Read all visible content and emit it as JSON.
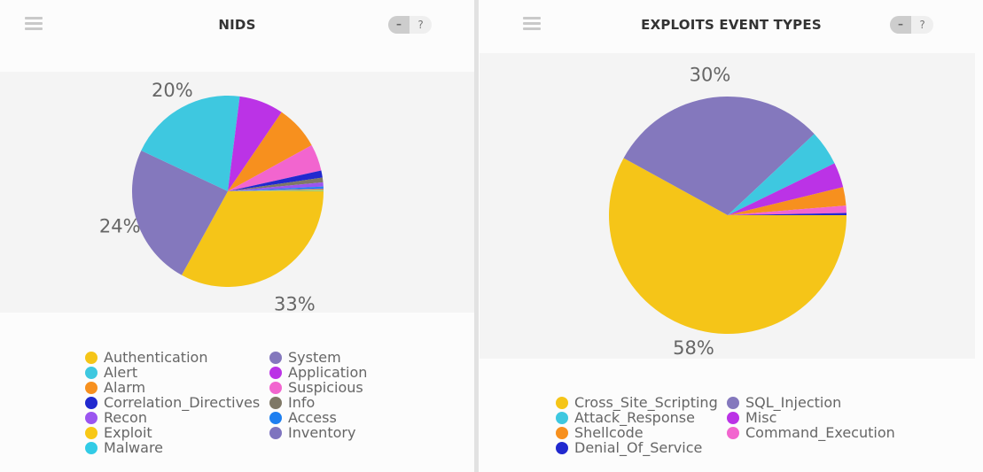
{
  "panels": [
    {
      "title": "NIDS",
      "controls": {
        "minimize_label": "–",
        "help_label": "?"
      },
      "icons": {
        "menu": "hamburger-menu-icon"
      }
    },
    {
      "title": "EXPLOITS EVENT TYPES",
      "controls": {
        "minimize_label": "–",
        "help_label": "?"
      },
      "icons": {
        "menu": "hamburger-menu-icon"
      }
    }
  ],
  "chart_data": [
    {
      "type": "pie",
      "title": "NIDS",
      "start_angle": "3 o'clock, clockwise",
      "slices": [
        {
          "label": "Authentication",
          "value": 33,
          "color": "#f5c518",
          "data_label": "33%"
        },
        {
          "label": "System",
          "value": 24,
          "color": "#8478bd",
          "data_label": "24%"
        },
        {
          "label": "Alert",
          "value": 20,
          "color": "#3ec8e0",
          "data_label": "20%"
        },
        {
          "label": "Application",
          "value": 7.5,
          "color": "#bb33e6",
          "data_label": ""
        },
        {
          "label": "Alarm",
          "value": 7.5,
          "color": "#f7901e",
          "data_label": ""
        },
        {
          "label": "Suspicious",
          "value": 4.5,
          "color": "#f265cf",
          "data_label": ""
        },
        {
          "label": "Correlation_Directives",
          "value": 1.2,
          "color": "#2129cf",
          "data_label": ""
        },
        {
          "label": "Info",
          "value": 0.8,
          "color": "#7f7866",
          "data_label": ""
        },
        {
          "label": "Recon",
          "value": 0.7,
          "color": "#9b55f0",
          "data_label": ""
        },
        {
          "label": "Access",
          "value": 0.3,
          "color": "#1e7ff0",
          "data_label": ""
        },
        {
          "label": "Inventory",
          "value": 0.2,
          "color": "#7e74bf",
          "data_label": ""
        },
        {
          "label": "Exploit",
          "value": 0.2,
          "color": "#f8c815",
          "data_label": ""
        },
        {
          "label": "Malware",
          "value": 0.1,
          "color": "#32cbe6",
          "data_label": ""
        }
      ],
      "legend": {
        "placement": "bottom",
        "columns": [
          [
            "Authentication",
            "Alert",
            "Alarm",
            "Correlation_Directives",
            "Recon",
            "Exploit",
            "Malware"
          ],
          [
            "System",
            "Application",
            "Suspicious",
            "Info",
            "Access",
            "Inventory"
          ]
        ]
      }
    },
    {
      "type": "pie",
      "title": "EXPLOITS EVENT TYPES",
      "start_angle": "3 o'clock, clockwise",
      "slices": [
        {
          "label": "Cross_Site_Scripting",
          "value": 58,
          "color": "#f5c518",
          "data_label": "58%"
        },
        {
          "label": "SQL_Injection",
          "value": 30,
          "color": "#8478bd",
          "data_label": "30%"
        },
        {
          "label": "Attack_Response",
          "value": 4.8,
          "color": "#3ec8e0",
          "data_label": ""
        },
        {
          "label": "Misc",
          "value": 3.4,
          "color": "#bb33e6",
          "data_label": ""
        },
        {
          "label": "Shellcode",
          "value": 2.5,
          "color": "#f7901e",
          "data_label": ""
        },
        {
          "label": "Command_Execution",
          "value": 1.0,
          "color": "#f265cf",
          "data_label": ""
        },
        {
          "label": "Denial_Of_Service",
          "value": 0.3,
          "color": "#2129cf",
          "data_label": ""
        }
      ],
      "legend": {
        "placement": "bottom",
        "columns": [
          [
            "Cross_Site_Scripting",
            "Attack_Response",
            "Shellcode",
            "Denial_Of_Service"
          ],
          [
            "SQL_Injection",
            "Misc",
            "Command_Execution"
          ]
        ]
      }
    }
  ]
}
